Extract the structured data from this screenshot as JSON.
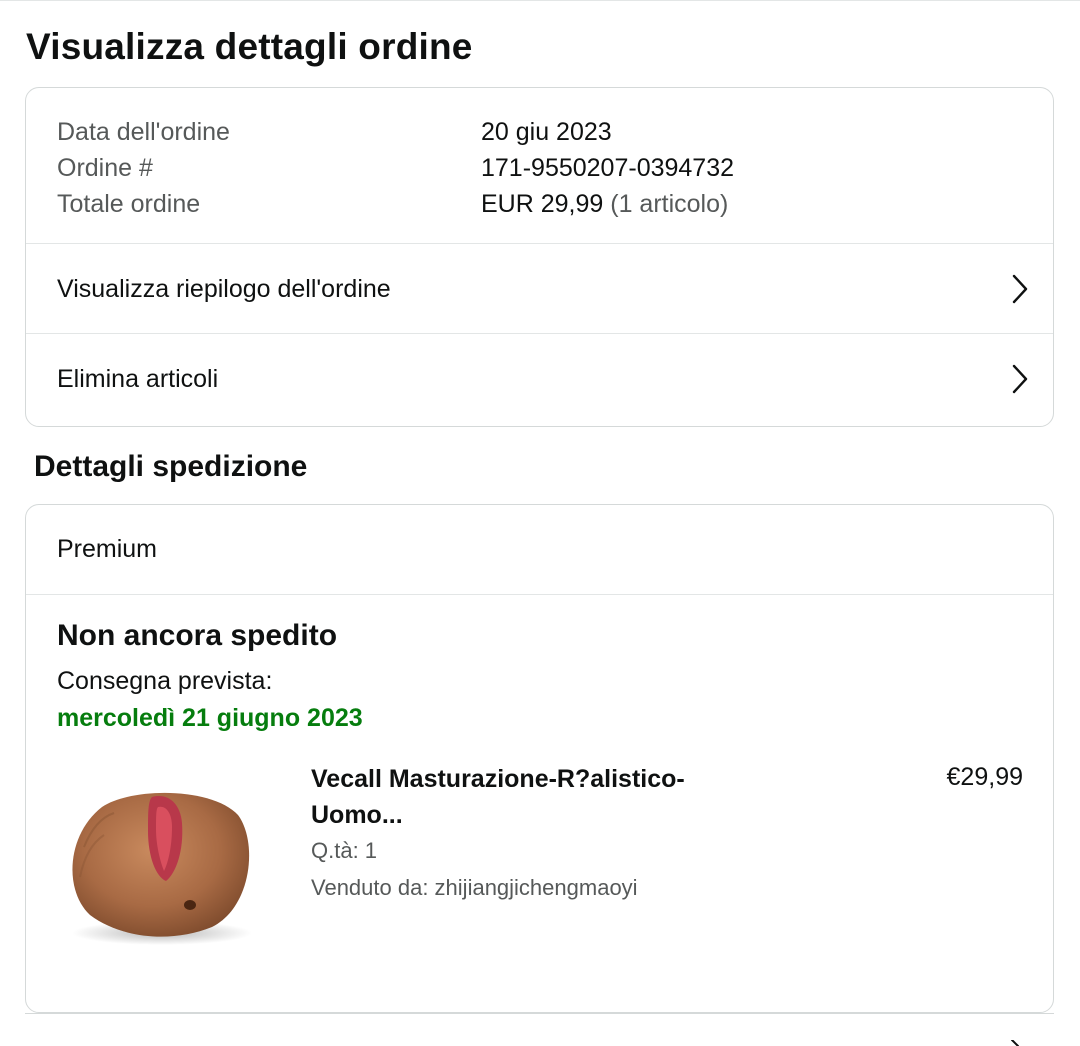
{
  "page": {
    "title": "Visualizza dettagli ordine"
  },
  "order_info": {
    "rows": [
      {
        "label": "Data dell'ordine",
        "value": "20 giu 2023",
        "extra": ""
      },
      {
        "label": "Ordine #",
        "value": "171-9550207-0394732",
        "extra": ""
      },
      {
        "label": "Totale ordine",
        "value": "EUR 29,99",
        "extra": " (1 articolo)"
      }
    ],
    "links": [
      {
        "label": "Visualizza riepilogo dell'ordine",
        "icon": "chevron-right-icon"
      },
      {
        "label": "Elimina articoli",
        "icon": "chevron-right-icon"
      }
    ]
  },
  "shipment": {
    "section_title": "Dettagli spedizione",
    "method": "Premium",
    "status": "Non ancora spedito",
    "eta_label": "Consegna prevista:",
    "eta_date": "mercoledì 21 giugno 2023",
    "eta_color": "#067d0e",
    "item": {
      "title": "Vecall Masturazione-R?alistico-Uomo...",
      "qty": "Q.tà: 1",
      "seller": "Venduto da: zhijiangjichengmaoyi",
      "price": "€29,99",
      "image_icon": "product-thumbnail"
    }
  },
  "colors": {
    "text": "#0f1111",
    "muted": "#565959",
    "border": "#d5d9d9",
    "success": "#067d0e"
  }
}
